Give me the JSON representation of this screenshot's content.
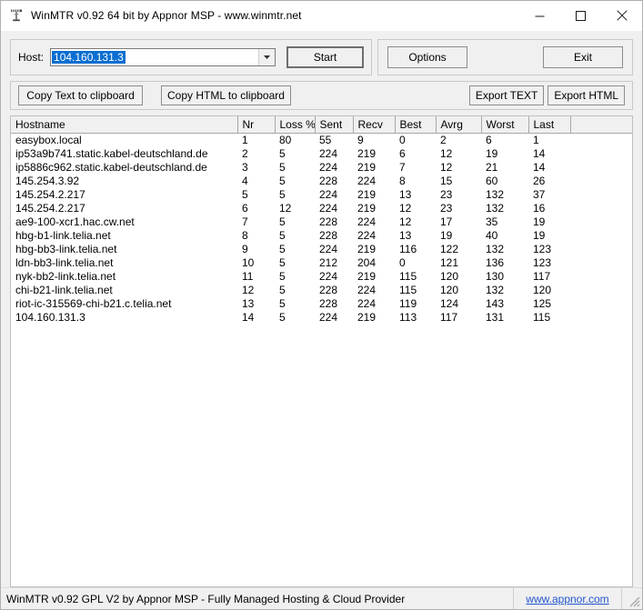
{
  "window": {
    "title": "WinMTR v0.92 64 bit by Appnor MSP - www.winmtr.net",
    "app_icon": "antenna-icon",
    "minimize_label": "–",
    "maximize_label": "□",
    "close_label": "✕"
  },
  "host_panel": {
    "label": "Host:",
    "value": "104.160.131.3",
    "placeholder": "",
    "dropdown_icon": "chevron-down-icon",
    "start_label": "Start"
  },
  "action_panel": {
    "options_label": "Options",
    "exit_label": "Exit"
  },
  "copy_panel": {
    "copy_text_label": "Copy Text to clipboard",
    "copy_html_label": "Copy HTML to clipboard",
    "export_text_label": "Export TEXT",
    "export_html_label": "Export HTML"
  },
  "table": {
    "columns": [
      "Hostname",
      "Nr",
      "Loss %",
      "Sent",
      "Recv",
      "Best",
      "Avrg",
      "Worst",
      "Last"
    ],
    "rows": [
      {
        "hostname": "easybox.local",
        "nr": "1",
        "loss": "80",
        "sent": "55",
        "recv": "9",
        "best": "0",
        "avrg": "2",
        "worst": "6",
        "last": "1"
      },
      {
        "hostname": "ip53a9b741.static.kabel-deutschland.de",
        "nr": "2",
        "loss": "5",
        "sent": "224",
        "recv": "219",
        "best": "6",
        "avrg": "12",
        "worst": "19",
        "last": "14"
      },
      {
        "hostname": "ip5886c962.static.kabel-deutschland.de",
        "nr": "3",
        "loss": "5",
        "sent": "224",
        "recv": "219",
        "best": "7",
        "avrg": "12",
        "worst": "21",
        "last": "14"
      },
      {
        "hostname": "145.254.3.92",
        "nr": "4",
        "loss": "5",
        "sent": "228",
        "recv": "224",
        "best": "8",
        "avrg": "15",
        "worst": "60",
        "last": "26"
      },
      {
        "hostname": "145.254.2.217",
        "nr": "5",
        "loss": "5",
        "sent": "224",
        "recv": "219",
        "best": "13",
        "avrg": "23",
        "worst": "132",
        "last": "37"
      },
      {
        "hostname": "145.254.2.217",
        "nr": "6",
        "loss": "12",
        "sent": "224",
        "recv": "219",
        "best": "12",
        "avrg": "23",
        "worst": "132",
        "last": "16"
      },
      {
        "hostname": "ae9-100-xcr1.hac.cw.net",
        "nr": "7",
        "loss": "5",
        "sent": "228",
        "recv": "224",
        "best": "12",
        "avrg": "17",
        "worst": "35",
        "last": "19"
      },
      {
        "hostname": "hbg-b1-link.telia.net",
        "nr": "8",
        "loss": "5",
        "sent": "228",
        "recv": "224",
        "best": "13",
        "avrg": "19",
        "worst": "40",
        "last": "19"
      },
      {
        "hostname": "hbg-bb3-link.telia.net",
        "nr": "9",
        "loss": "5",
        "sent": "224",
        "recv": "219",
        "best": "116",
        "avrg": "122",
        "worst": "132",
        "last": "123"
      },
      {
        "hostname": "ldn-bb3-link.telia.net",
        "nr": "10",
        "loss": "5",
        "sent": "212",
        "recv": "204",
        "best": "0",
        "avrg": "121",
        "worst": "136",
        "last": "123"
      },
      {
        "hostname": "nyk-bb2-link.telia.net",
        "nr": "11",
        "loss": "5",
        "sent": "224",
        "recv": "219",
        "best": "115",
        "avrg": "120",
        "worst": "130",
        "last": "117"
      },
      {
        "hostname": "chi-b21-link.telia.net",
        "nr": "12",
        "loss": "5",
        "sent": "228",
        "recv": "224",
        "best": "115",
        "avrg": "120",
        "worst": "132",
        "last": "120"
      },
      {
        "hostname": "riot-ic-315569-chi-b21.c.telia.net",
        "nr": "13",
        "loss": "5",
        "sent": "228",
        "recv": "224",
        "best": "119",
        "avrg": "124",
        "worst": "143",
        "last": "125"
      },
      {
        "hostname": "104.160.131.3",
        "nr": "14",
        "loss": "5",
        "sent": "224",
        "recv": "219",
        "best": "113",
        "avrg": "117",
        "worst": "131",
        "last": "115"
      }
    ]
  },
  "statusbar": {
    "text": "WinMTR v0.92 GPL V2 by Appnor MSP - Fully Managed Hosting & Cloud Provider",
    "link": "www.appnor.com",
    "grip_icon": "resize-grip-icon"
  },
  "colors": {
    "selection": "#0a6ed1",
    "window_bg": "#f0f0f0",
    "link": "#2255cc"
  }
}
